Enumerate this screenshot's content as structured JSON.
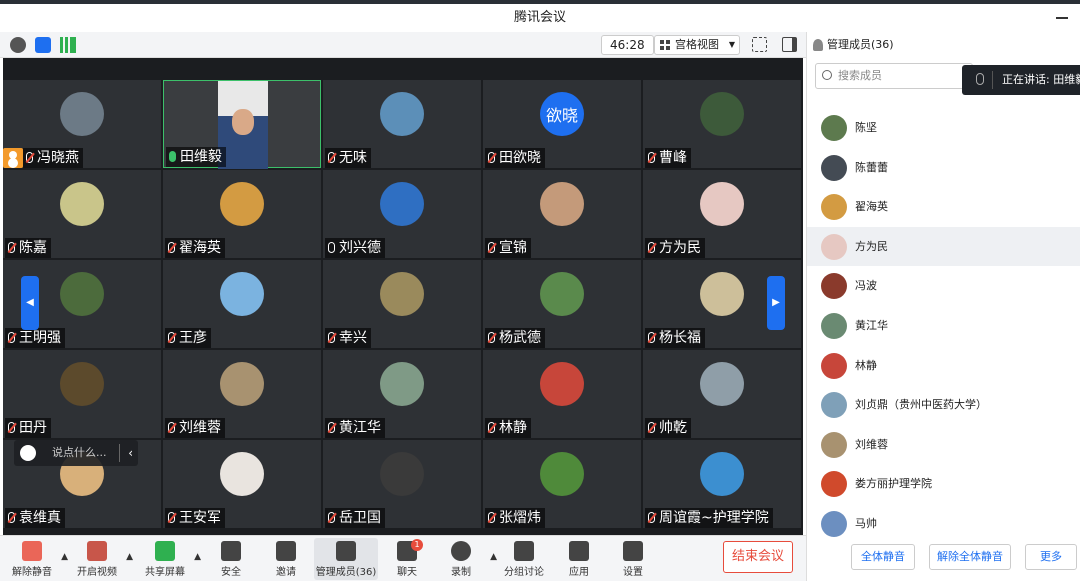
{
  "window": {
    "title": "腾讯会议"
  },
  "toolbar": {
    "timer": "46:28",
    "view_label": "宫格视图"
  },
  "tiles": [
    {
      "name": "冯晓燕",
      "mic": "muted",
      "avatar": "#6c7a86",
      "avatar_text": ""
    },
    {
      "name": "田维毅",
      "mic": "on",
      "avatar": "video",
      "avatar_text": ""
    },
    {
      "name": "无味",
      "mic": "muted",
      "avatar": "#5c8fb8",
      "avatar_text": ""
    },
    {
      "name": "田欲晓",
      "mic": "muted",
      "avatar": "#1e6ff0",
      "avatar_text": "欲晓"
    },
    {
      "name": "曹峰",
      "mic": "muted",
      "avatar": "#3d5a3a",
      "avatar_text": ""
    },
    {
      "name": "陈嘉",
      "mic": "muted",
      "avatar": "#c9c58a",
      "avatar_text": ""
    },
    {
      "name": "翟海英",
      "mic": "muted",
      "avatar": "#d39b42",
      "avatar_text": ""
    },
    {
      "name": "刘兴德",
      "mic": "off",
      "avatar": "#2f6fc2",
      "avatar_text": ""
    },
    {
      "name": "宣锦",
      "mic": "muted",
      "avatar": "#c49a7a",
      "avatar_text": ""
    },
    {
      "name": "方为民",
      "mic": "muted",
      "avatar": "#e6c8c2",
      "avatar_text": ""
    },
    {
      "name": "王明强",
      "mic": "muted",
      "avatar": "#4c6b3c",
      "avatar_text": ""
    },
    {
      "name": "王彦",
      "mic": "muted",
      "avatar": "#7bb3e0",
      "avatar_text": ""
    },
    {
      "name": "幸兴",
      "mic": "muted",
      "avatar": "#9a8a5c",
      "avatar_text": ""
    },
    {
      "name": "杨武德",
      "mic": "muted",
      "avatar": "#5a8a4c",
      "avatar_text": ""
    },
    {
      "name": "杨长福",
      "mic": "muted",
      "avatar": "#cdbf9a",
      "avatar_text": ""
    },
    {
      "name": "田丹",
      "mic": "muted",
      "avatar": "#5c4a2c",
      "avatar_text": ""
    },
    {
      "name": "刘维蓉",
      "mic": "muted",
      "avatar": "#a89270",
      "avatar_text": ""
    },
    {
      "name": "黄江华",
      "mic": "muted",
      "avatar": "#7f9a86",
      "avatar_text": ""
    },
    {
      "name": "林静",
      "mic": "muted",
      "avatar": "#c7463a",
      "avatar_text": ""
    },
    {
      "name": "帅乾",
      "mic": "muted",
      "avatar": "#8f9ea8",
      "avatar_text": ""
    },
    {
      "name": "袁维真",
      "mic": "muted",
      "avatar": "#d8b07a",
      "avatar_text": ""
    },
    {
      "name": "王安军",
      "mic": "muted",
      "avatar": "#e9e4df",
      "avatar_text": ""
    },
    {
      "name": "岳卫国",
      "mic": "muted",
      "avatar": "#3a3a3a",
      "avatar_text": ""
    },
    {
      "name": "张熠炜",
      "mic": "muted",
      "avatar": "#4f8a3a",
      "avatar_text": ""
    },
    {
      "name": "周谊霞~护理学院",
      "mic": "muted",
      "avatar": "#3c8fd0",
      "avatar_text": ""
    }
  ],
  "chat_placeholder": "说点什么...",
  "bottom_bar": {
    "items": [
      {
        "label": "解除静音",
        "icon": "mic-muted-icon",
        "caret": true
      },
      {
        "label": "开启视频",
        "icon": "video-off-icon",
        "caret": true
      },
      {
        "label": "共享屏幕",
        "icon": "share-screen-icon",
        "caret": true
      },
      {
        "label": "安全",
        "icon": "shield-icon",
        "caret": false
      },
      {
        "label": "邀请",
        "icon": "invite-icon",
        "caret": false
      },
      {
        "label": "管理成员(36)",
        "icon": "members-icon",
        "caret": false
      },
      {
        "label": "聊天",
        "icon": "chat-icon",
        "caret": false,
        "badge": "1"
      },
      {
        "label": "录制",
        "icon": "record-icon",
        "caret": true
      },
      {
        "label": "分组讨论",
        "icon": "breakout-icon",
        "caret": false
      },
      {
        "label": "应用",
        "icon": "apps-icon",
        "caret": false
      },
      {
        "label": "设置",
        "icon": "gear-icon",
        "caret": false
      }
    ],
    "end_label": "结束会议"
  },
  "panel": {
    "title": "管理成员(36)",
    "search_placeholder": "搜索成员",
    "speaking": "正在讲话: 田维毅",
    "members": [
      {
        "name": "陈坚",
        "avatar": "#5d7a4e"
      },
      {
        "name": "陈蕾蕾",
        "avatar": "#444b54"
      },
      {
        "name": "翟海英",
        "avatar": "#d39b42"
      },
      {
        "name": "方为民",
        "avatar": "#e6c8c2"
      },
      {
        "name": "冯波",
        "avatar": "#8a3a2c"
      },
      {
        "name": "黄江华",
        "avatar": "#6a8a72"
      },
      {
        "name": "林静",
        "avatar": "#c7463a"
      },
      {
        "name": "刘贞鼎（贵州中医药大学）",
        "avatar": "#7fa0b8"
      },
      {
        "name": "刘维蓉",
        "avatar": "#a89270"
      },
      {
        "name": "娄方丽护理学院",
        "avatar": "#d04a2c"
      },
      {
        "name": "马帅",
        "avatar": "#6c8fc0"
      }
    ],
    "mute_all": "全体静音",
    "unmute_all": "解除全体静音",
    "more": "更多"
  }
}
